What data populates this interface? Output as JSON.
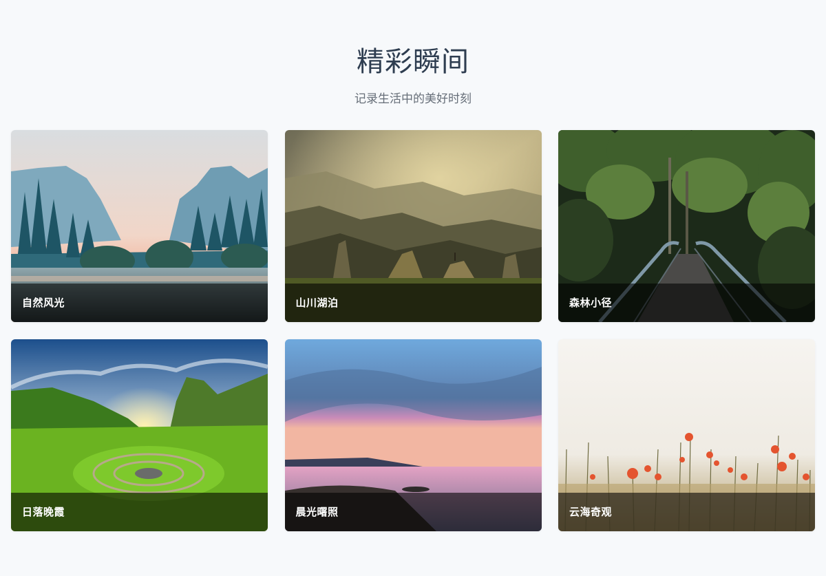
{
  "header": {
    "title": "精彩瞬间",
    "subtitle": "记录生活中的美好时刻"
  },
  "gallery": {
    "items": [
      {
        "label": "自然风光",
        "scene": "valley-mountains-image"
      },
      {
        "label": "山川湖泊",
        "scene": "golden-hills-image"
      },
      {
        "label": "森林小径",
        "scene": "forest-bridge-image"
      },
      {
        "label": "日落晚霞",
        "scene": "green-sunset-hills-image"
      },
      {
        "label": "晨光曙照",
        "scene": "seaside-dawn-image"
      },
      {
        "label": "云海奇观",
        "scene": "poppy-field-image"
      }
    ]
  },
  "colors": {
    "background": "#f7f9fb",
    "title": "#2e3d50",
    "subtitle": "#666e78",
    "caption_overlay": "#000000"
  }
}
